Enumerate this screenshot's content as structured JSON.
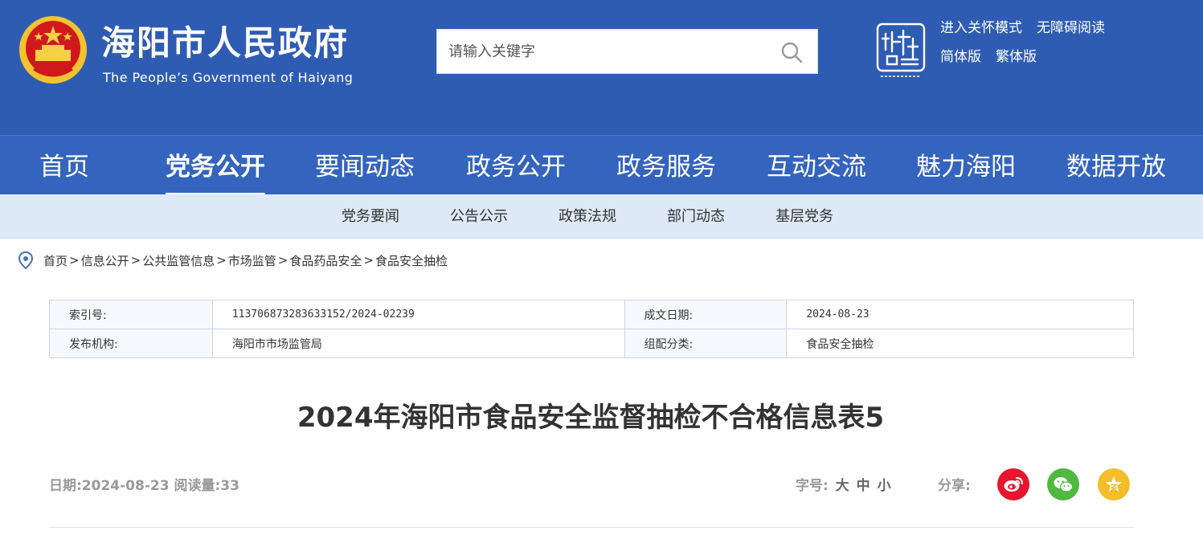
{
  "header": {
    "site_title": "海阳市人民政府",
    "site_subtitle": "The People’s Government of Haiyang",
    "search_placeholder": "请输入关键字",
    "links": [
      "进入关怀模式",
      "无障碍阅读",
      "简体版",
      "繁体版"
    ],
    "brand_color": "#2f5cb3"
  },
  "main_nav": [
    {
      "label": "首页",
      "active": false
    },
    {
      "label": "党务公开",
      "active": true
    },
    {
      "label": "要闻动态",
      "active": false
    },
    {
      "label": "政务公开",
      "active": false
    },
    {
      "label": "政务服务",
      "active": false
    },
    {
      "label": "互动交流",
      "active": false
    },
    {
      "label": "魅力海阳",
      "active": false
    },
    {
      "label": "数据开放",
      "active": false
    }
  ],
  "sub_nav": [
    "党务要闻",
    "公告公示",
    "政策法规",
    "部门动态",
    "基层党务"
  ],
  "breadcrumb": [
    "首页",
    "信息公开",
    "公共监管信息",
    "市场监管",
    "食品药品安全",
    "食品安全抽检"
  ],
  "breadcrumb_separator": ">",
  "info": {
    "index_label": "索引号:",
    "index_value": "113706873283633152/2024-02239",
    "date_label": "成文日期:",
    "date_value": "2024-08-23",
    "org_label": "发布机构:",
    "org_value": "海阳市市场监管局",
    "category_label": "组配分类:",
    "category_value": "食品安全抽检"
  },
  "article": {
    "title": "2024年海阳市食品安全监督抽检不合格信息表5",
    "meta": "日期:2024-08-23 阅读量:33",
    "font_size_label": "字号:",
    "font_sizes": [
      "大",
      "中",
      "小"
    ],
    "share_label": "分享:"
  },
  "share_icons": [
    "weibo-icon",
    "wechat-icon",
    "qzone-icon"
  ]
}
